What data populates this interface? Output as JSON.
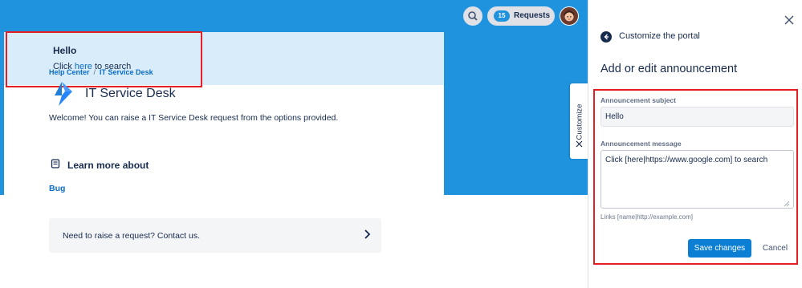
{
  "announcement": {
    "title": "Hello",
    "message_prefix": "Click ",
    "message_link": "here",
    "message_suffix": " to search"
  },
  "breadcrumb": {
    "items": [
      "Help Center",
      "IT Service Desk"
    ],
    "separator": "/"
  },
  "portal": {
    "title": "IT Service Desk",
    "welcome": "Welcome! You can raise a IT Service Desk request from the options provided.",
    "learn_more_heading": "Learn more about",
    "learn_more_link": "Bug",
    "contact_text": "Need to raise a request? Contact us."
  },
  "header": {
    "requests_count": "15",
    "requests_label": "Requests"
  },
  "customize_tab": {
    "label": "Customize"
  },
  "panel": {
    "nav_title": "Customize the portal",
    "title": "Add or edit announcement",
    "subject_label": "Announcement subject",
    "subject_value": "Hello",
    "message_label": "Announcement message",
    "message_value": "Click [here|https://www.google.com] to search",
    "hint": "Links [name|http://example.com]",
    "save_label": "Save changes",
    "cancel_label": "Cancel"
  },
  "colors": {
    "header_blue": "#1f93dd",
    "announcement_bg": "#d8edf9",
    "link_blue": "#0b6bc7",
    "primary_button": "#0c7fd4",
    "highlight_red": "#e41f23"
  },
  "icons": [
    "search-icon",
    "avatar",
    "close-icon",
    "back-arrow-icon",
    "bolt-logo-icon",
    "book-icon",
    "chevron-right-icon",
    "resize-grip-icon"
  ]
}
